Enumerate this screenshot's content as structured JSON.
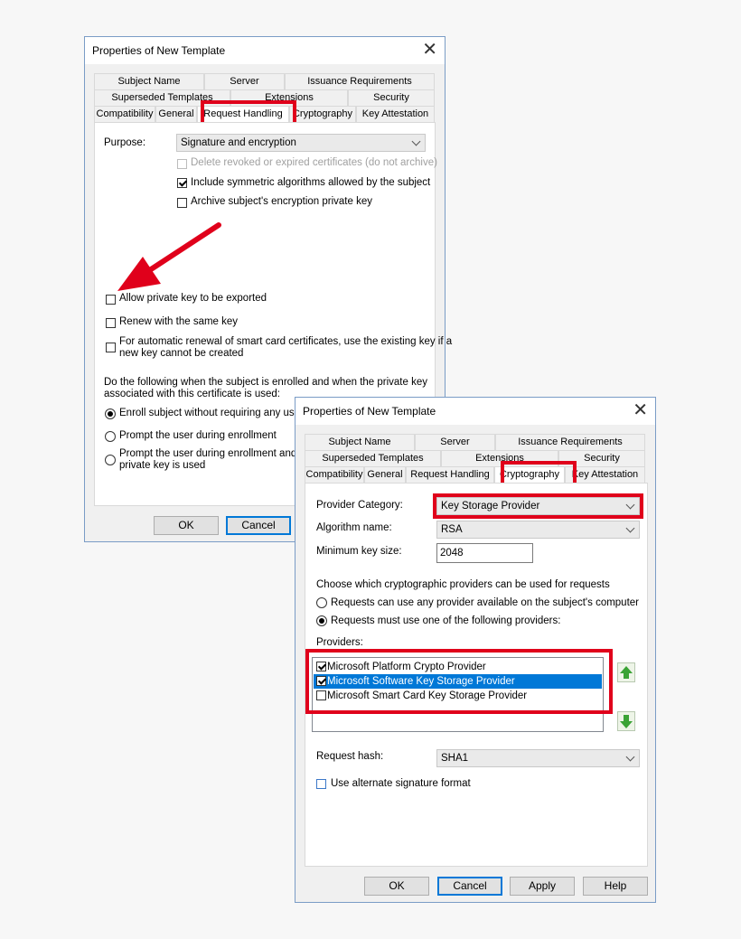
{
  "dialog1": {
    "title": "Properties of New Template",
    "tabs_row1": [
      "Subject Name",
      "Server",
      "Issuance Requirements"
    ],
    "tabs_row2": [
      "Superseded Templates",
      "Extensions",
      "Security"
    ],
    "tabs_row3": [
      "Compatibility",
      "General",
      "Request Handling",
      "Cryptography",
      "Key Attestation"
    ],
    "purpose_label": "Purpose:",
    "purpose_value": "Signature and encryption",
    "opt_delete_revoked": "Delete revoked or expired certificates (do not archive)",
    "opt_include_symmetric": "Include symmetric algorithms allowed by the subject",
    "opt_archive_key": "Archive subject's encryption private key",
    "opt_allow_export": "Allow private key to be exported",
    "opt_renew_same_key": "Renew with the same key",
    "opt_smart_card_line1": "For automatic renewal of smart card certificates, use the existing key if a",
    "opt_smart_card_line2": "new key cannot be created",
    "enroll_text_line1": "Do the following when the subject is enrolled and when the private key",
    "enroll_text_line2": "associated with this certificate is used:",
    "radio_enroll": "Enroll subject without requiring any user in",
    "radio_prompt_enroll": "Prompt the user during enrollment",
    "radio_prompt_use_line1": "Prompt the user during enrollment and req",
    "radio_prompt_use_line2": "private key is used",
    "ok": "OK",
    "cancel": "Cancel"
  },
  "dialog2": {
    "title": "Properties of New Template",
    "tabs_row1": [
      "Subject Name",
      "Server",
      "Issuance Requirements"
    ],
    "tabs_row2": [
      "Superseded Templates",
      "Extensions",
      "Security"
    ],
    "tabs_row3": [
      "Compatibility",
      "General",
      "Request Handling",
      "Cryptography",
      "Key Attestation"
    ],
    "provider_category_label": "Provider Category:",
    "provider_category_value": "Key Storage Provider",
    "algorithm_label": "Algorithm name:",
    "algorithm_value": "RSA",
    "min_key_label": "Minimum key size:",
    "min_key_value": "2048",
    "choose_text": "Choose which cryptographic providers can be used for requests",
    "radio_any": "Requests can use any provider available on the subject's computer",
    "radio_must": "Requests must use one of the following providers:",
    "providers_label": "Providers:",
    "providers": [
      {
        "name": "Microsoft Platform Crypto Provider",
        "checked": true
      },
      {
        "name": "Microsoft Software Key Storage Provider",
        "checked": true
      },
      {
        "name": "Microsoft Smart Card Key Storage Provider",
        "checked": false
      }
    ],
    "hash_label": "Request hash:",
    "hash_value": "SHA1",
    "alt_sig": "Use alternate signature format",
    "ok": "OK",
    "cancel": "Cancel",
    "apply": "Apply",
    "help": "Help"
  },
  "colors": {
    "highlight": "#e0001b",
    "selection": "#0078d7",
    "up_arrow": "#3aa335"
  }
}
